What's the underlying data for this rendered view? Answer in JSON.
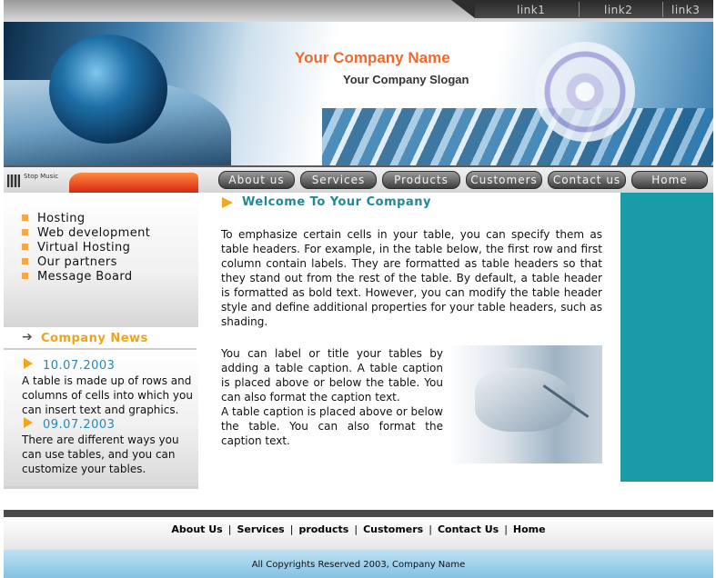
{
  "top_links": [
    "link1",
    "link2",
    "link3"
  ],
  "banner": {
    "company_name": "Your Company Name",
    "slogan": "Your Company Slogan"
  },
  "music": {
    "label": "Stop Music"
  },
  "nav": [
    "About us",
    "Services",
    "Products",
    "Customers",
    "Contact us",
    "Home"
  ],
  "sidebar": {
    "items": [
      "Hosting",
      "Web development",
      "Virtual Hosting",
      "Our partners",
      "Message Board"
    ]
  },
  "news": {
    "title": "Company News",
    "entries": [
      {
        "date": "10.07.2003",
        "text": "A table is made up of rows and columns of cells into which you can insert text and graphics."
      },
      {
        "date": "09.07.2003",
        "text": "There are different ways you can use tables, and you can customize your tables."
      }
    ]
  },
  "main": {
    "title": "Welcome To Your Company",
    "para1": "To emphasize certain cells in your table, you can specify them as table headers. For example, in the table below, the first row and first column contain labels. They are formatted as table headers so that they stand out from the rest of the table. By default, a table header is formatted as bold text. However, you can modify the table header style and define additional properties for your table headers, such as shading.",
    "para2a": "You can label or title your tables by adding a table caption. A table caption is placed above or below the table. You can also format the caption text.",
    "para2b": "A table caption is placed above or below the table. You can also format the caption text."
  },
  "footer": {
    "links": [
      "About Us",
      "Services",
      "products",
      "Customers",
      "Contact Us",
      "Home"
    ],
    "copyright": "All Copyrights Reserved 2003, Company Name"
  },
  "colors": {
    "accent_orange": "#f2682a",
    "news_title": "#f0a21c",
    "date_blue": "#2389bd",
    "welcome_teal": "#1f8a96",
    "teal_column": "#1b9aa8"
  }
}
